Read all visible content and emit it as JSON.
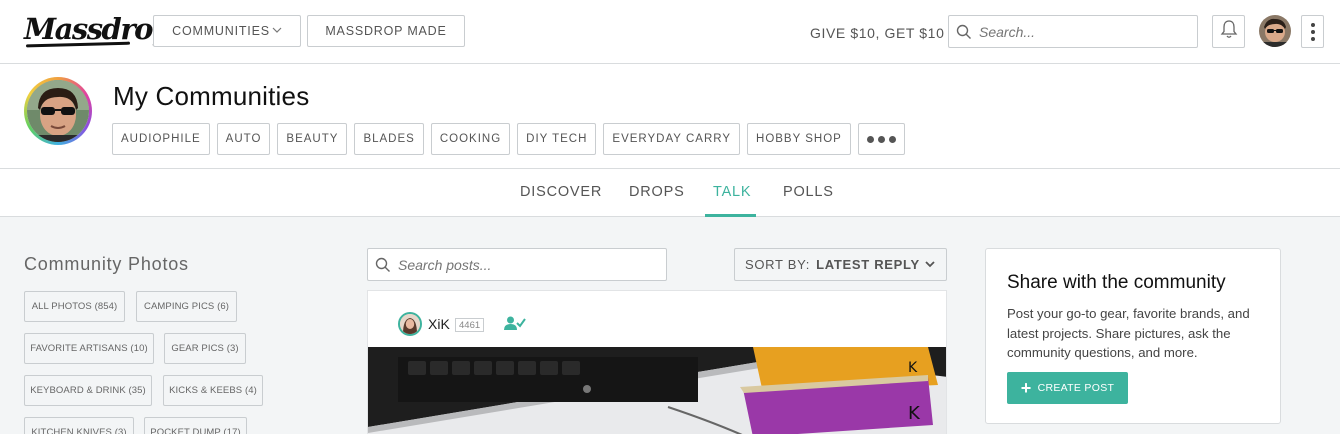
{
  "topbar": {
    "logo": "Massdrop",
    "communities_label": "COMMUNITIES",
    "massdrop_made_label": "MASSDROP MADE",
    "give_label": "GIVE $10, GET $10",
    "search_placeholder": "Search..."
  },
  "community": {
    "title": "My Communities",
    "pills": [
      "AUDIOPHILE",
      "AUTO",
      "BEAUTY",
      "BLADES",
      "COOKING",
      "DIY TECH",
      "EVERYDAY CARRY",
      "HOBBY SHOP"
    ]
  },
  "tabs": [
    {
      "label": "DISCOVER",
      "active": false
    },
    {
      "label": "DROPS",
      "active": false
    },
    {
      "label": "TALK",
      "active": true
    },
    {
      "label": "POLLS",
      "active": false
    }
  ],
  "photos": {
    "title": "Community Photos",
    "chips": [
      "ALL PHOTOS (854)",
      "CAMPING PICS (6)",
      "FAVORITE ARTISANS (10)",
      "GEAR PICS (3)",
      "KEYBOARD & DRINK (35)",
      "KICKS & KEEBS (4)",
      "KITCHEN KNIVES (3)",
      "POCKET DUMP (17)"
    ]
  },
  "feed": {
    "search_placeholder": "Search posts...",
    "sort_prefix": "SORT BY:",
    "sort_value": "LATEST REPLY",
    "post": {
      "user": "XiK",
      "count": "4461"
    }
  },
  "share": {
    "title": "Share with the community",
    "description": "Post your go-to gear, favorite brands, and latest projects. Share pictures, ask the community questions, and more.",
    "button_label": "CREATE POST"
  },
  "colors": {
    "accent": "#3db39e",
    "border": "#c9cdd0",
    "background": "#f3f5f6"
  }
}
